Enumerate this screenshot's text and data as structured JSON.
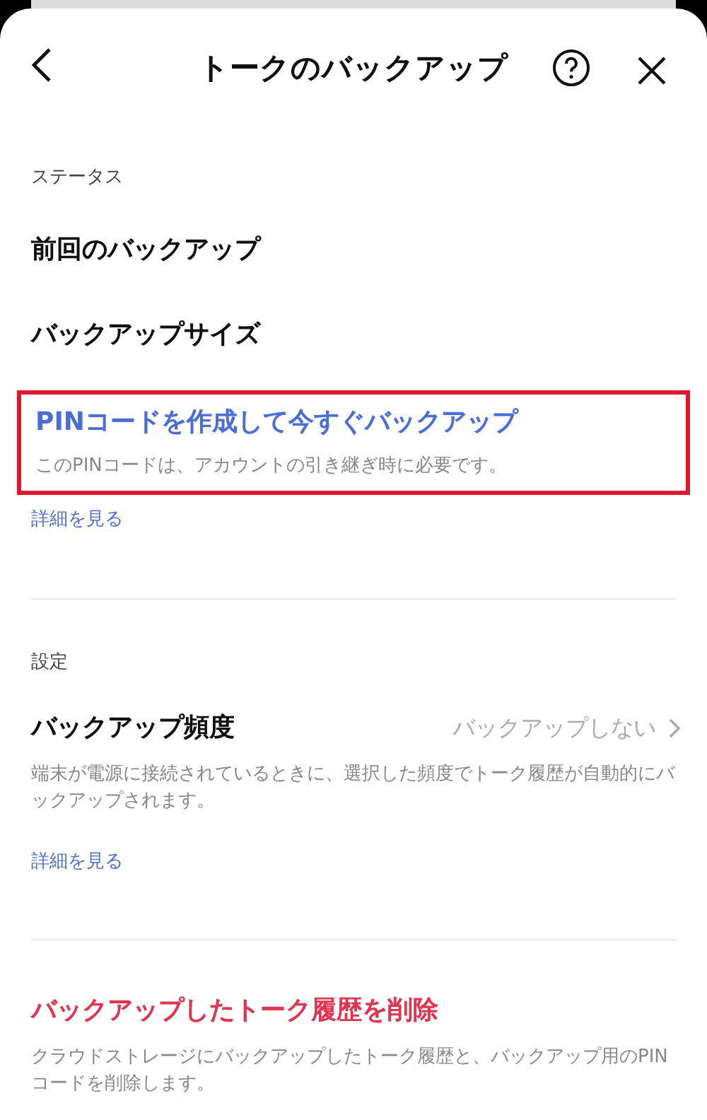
{
  "header": {
    "title": "トークのバックアップ"
  },
  "sections": [
    {
      "label": "ステータス",
      "items": [
        {
          "kind": "plain",
          "title": "前回のバックアップ"
        },
        {
          "kind": "plain",
          "title": "バックアップサイズ"
        },
        {
          "kind": "action",
          "title": "PINコードを作成して今すぐバックアップ",
          "description": "このPINコードは、アカウントの引き継ぎ時に必要です。",
          "highlighted": true,
          "link": "詳細を見る"
        }
      ]
    },
    {
      "label": "設定",
      "items": [
        {
          "kind": "setting",
          "title": "バックアップ頻度",
          "value": "バックアップしない",
          "description": "端末が電源に接続されているときに、選択した頻度でトーク履歴が自動的にバックアップされます。",
          "link": "詳細を見る"
        }
      ]
    },
    {
      "items": [
        {
          "kind": "danger",
          "title": "バックアップしたトーク履歴を削除",
          "description": "クラウドストレージにバックアップしたトーク履歴と、バックアップ用のPINコードを削除します。"
        }
      ]
    }
  ]
}
